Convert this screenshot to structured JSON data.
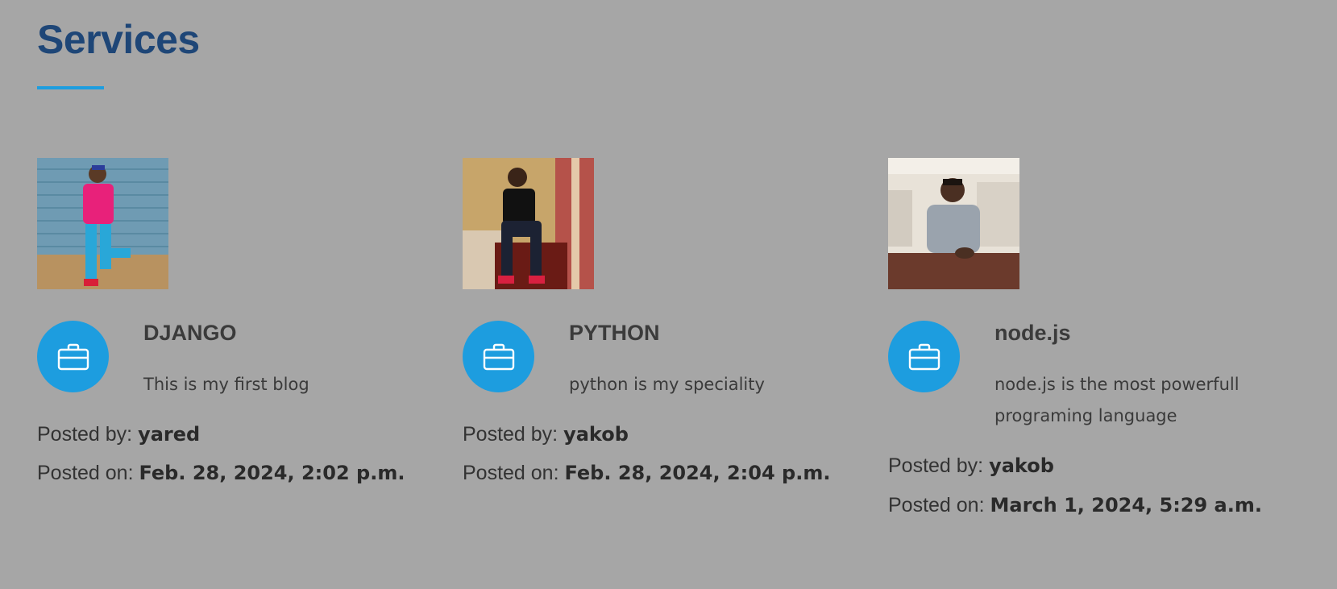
{
  "section": {
    "title": "Services"
  },
  "posted_by_label": "Posted by:",
  "posted_on_label": "Posted on:",
  "accent_color": "#1d9ddf",
  "title_color": "#1e4677",
  "background_color": "#a6a6a6",
  "posts": [
    {
      "title": "DJANGO",
      "description": "This is my first blog",
      "author": "yared",
      "date": "Feb. 28, 2024, 2:02 p.m.",
      "icon": "briefcase-icon"
    },
    {
      "title": "PYTHON",
      "description": "python is my speciality",
      "author": "yakob",
      "date": "Feb. 28, 2024, 2:04 p.m.",
      "icon": "briefcase-icon"
    },
    {
      "title": "node.js",
      "description": "node.js is the most powerfull programing language",
      "author": "yakob",
      "date": "March 1, 2024, 5:29 a.m.",
      "icon": "briefcase-icon"
    }
  ]
}
